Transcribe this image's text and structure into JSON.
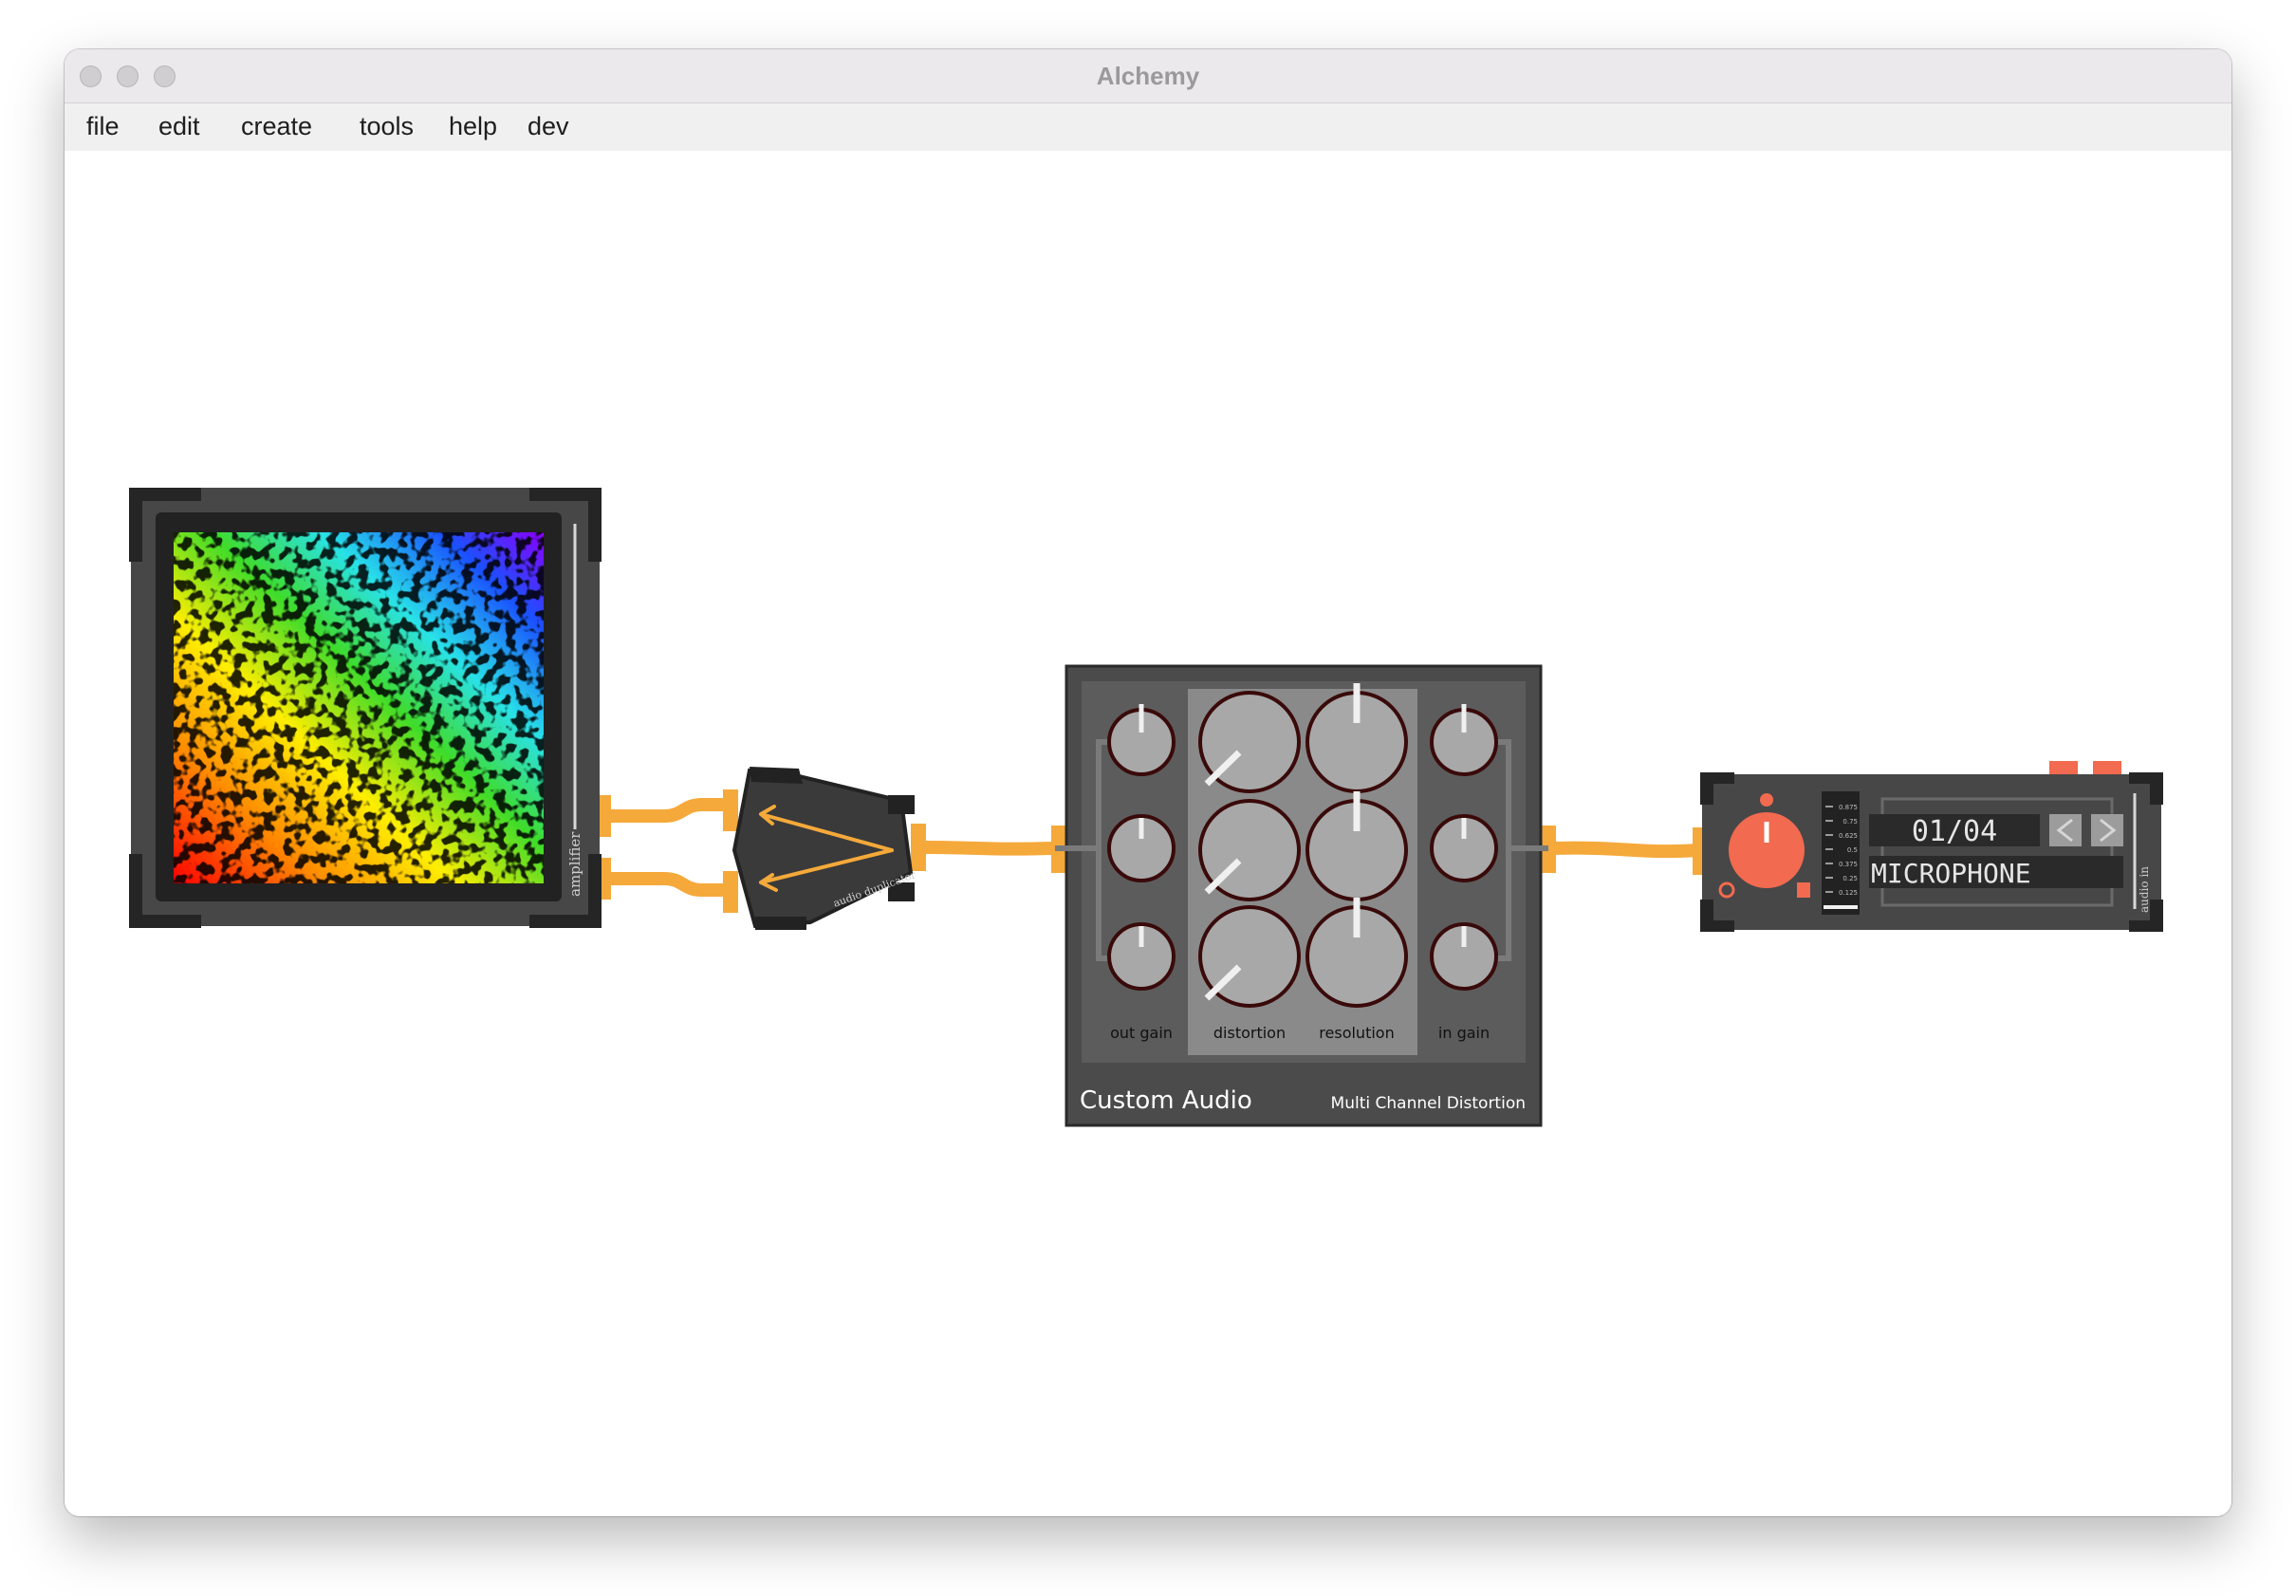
{
  "window": {
    "title": "Alchemy"
  },
  "menu": {
    "items": [
      "file",
      "edit",
      "create",
      "tools",
      "help",
      "dev"
    ]
  },
  "amplifier": {
    "label": "amplifier"
  },
  "duplicator": {
    "label": "audio duplicator"
  },
  "distortion": {
    "brand": "Custom Audio",
    "model": "Multi Channel Distortion",
    "labels": {
      "out_gain": "out gain",
      "distortion": "distortion",
      "resolution": "resolution",
      "in_gain": "in gain"
    }
  },
  "audio_in": {
    "label": "audio in",
    "counter": "01/04",
    "source": "MICROPHONE",
    "meter_ticks": [
      "0.875",
      "0.75",
      "0.625",
      "0.5",
      "0.375",
      "0.25",
      "0.125"
    ],
    "prev_icon": "chevron-left-icon",
    "next_icon": "chevron-right-icon"
  },
  "colors": {
    "cable": "#f5a93a",
    "accent": "#f26a4f",
    "panel": "#4a4a4a",
    "frame": "#2b2b2b"
  }
}
